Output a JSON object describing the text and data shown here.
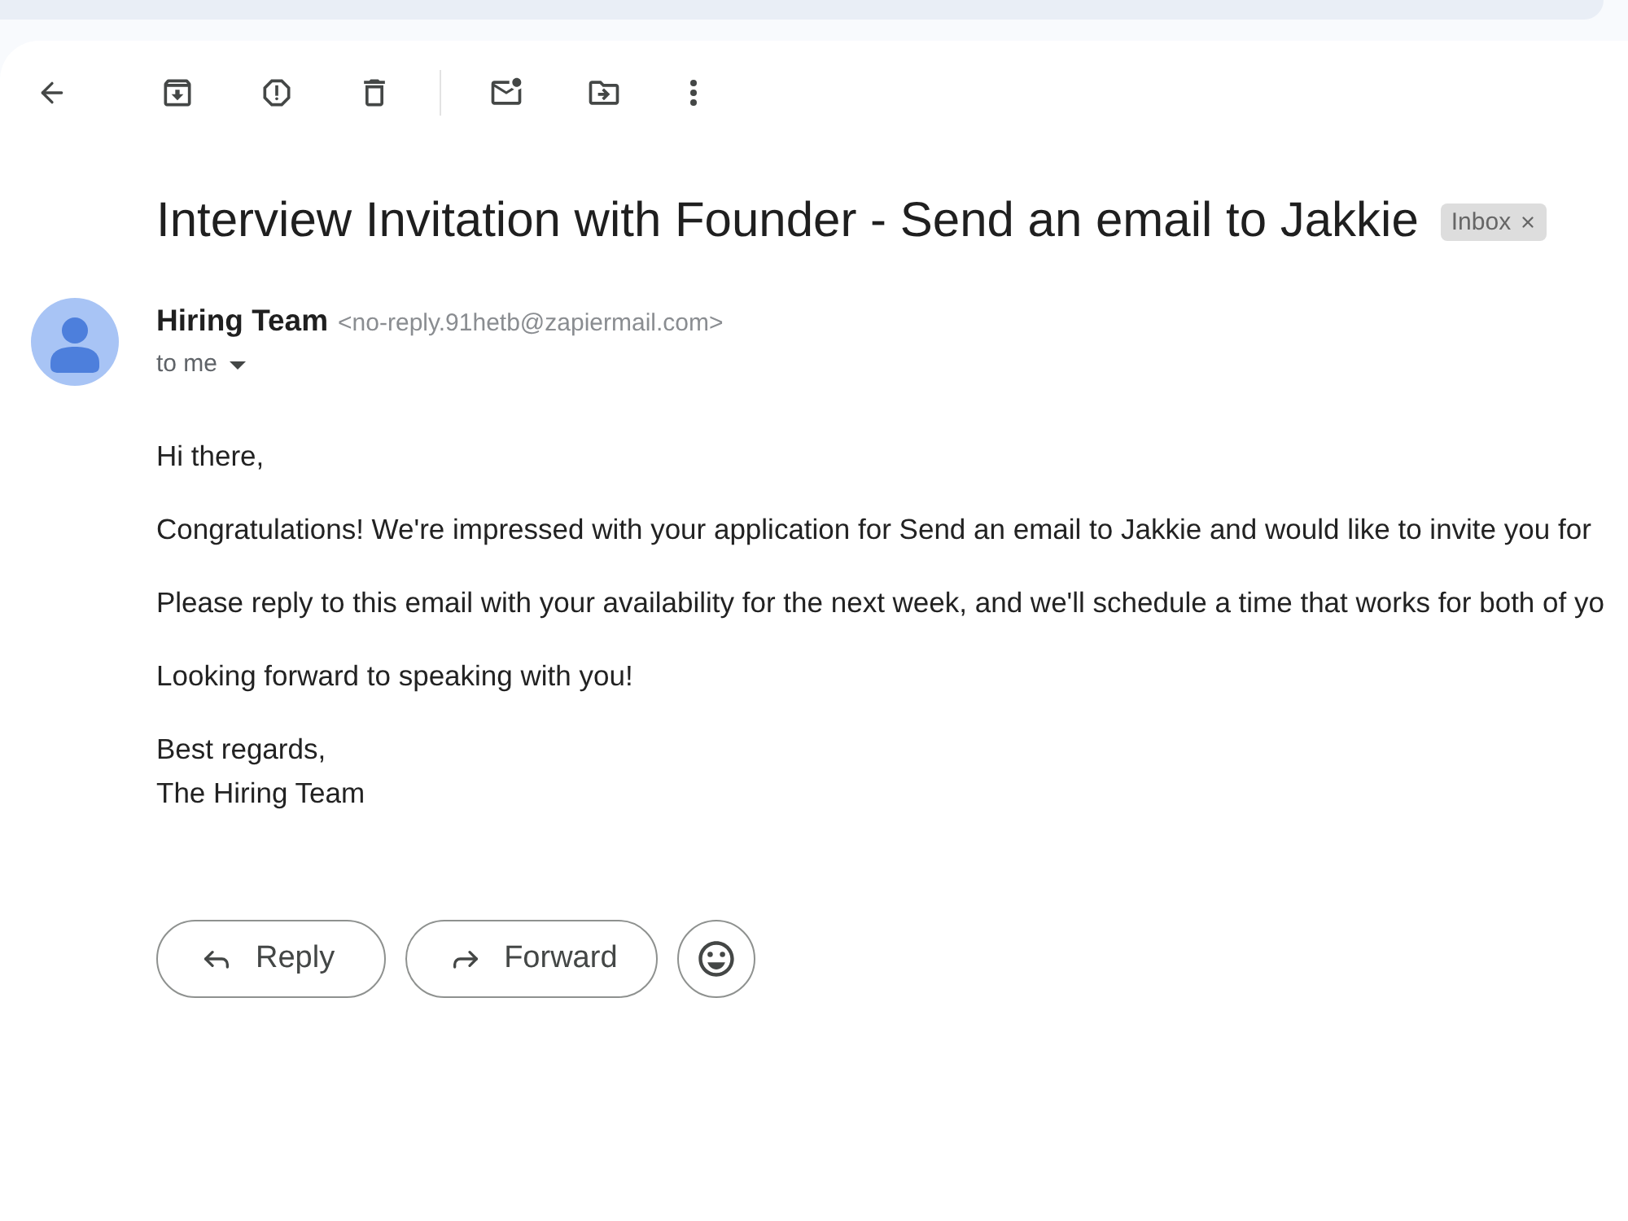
{
  "message": {
    "subject": "Interview Invitation with Founder - Send an email to Jakkie",
    "labels": [
      {
        "label": "Inbox"
      }
    ],
    "sender": {
      "name": "Hiring Team",
      "email": "<no-reply.91hetb@zapiermail.com>",
      "recipient": "to me"
    },
    "body": [
      {
        "lines": [
          "Hi there,"
        ]
      },
      {
        "lines": [
          "Congratulations! We're impressed with your application for Send an email to Jakkie and would like to invite you for"
        ]
      },
      {
        "lines": [
          "Please reply to this email with your availability for the next week, and we'll schedule a time that works for both of yo"
        ]
      },
      {
        "lines": [
          "Looking forward to speaking with you!"
        ]
      },
      {
        "lines": [
          "Best regards,",
          "The Hiring Team"
        ]
      }
    ],
    "actions": [
      {
        "kind": "reply",
        "label": "Reply"
      },
      {
        "kind": "forward",
        "label": "Forward"
      },
      {
        "kind": "emoji"
      }
    ]
  }
}
